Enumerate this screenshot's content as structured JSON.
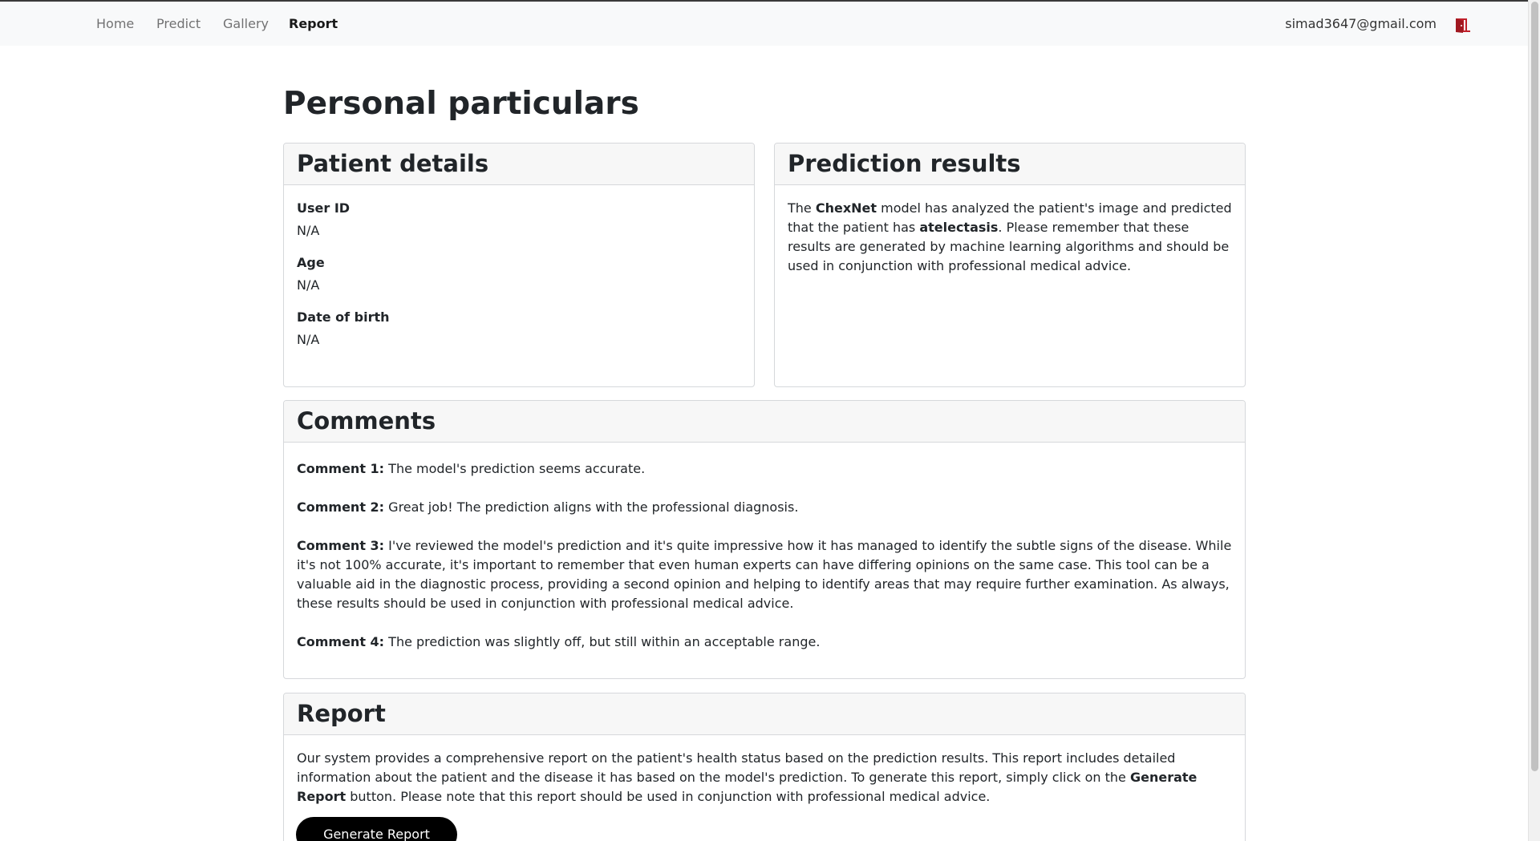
{
  "nav": {
    "items": [
      {
        "label": "Home",
        "active": false
      },
      {
        "label": "Predict",
        "active": false
      },
      {
        "label": "Gallery",
        "active": false
      },
      {
        "label": "Report",
        "active": true
      }
    ],
    "user_email": "simad3647@gmail.com",
    "logout_icon": "logout-door-icon",
    "logout_color": "#c0202a"
  },
  "page": {
    "title": "Personal particulars"
  },
  "patient": {
    "header": "Patient details",
    "fields": [
      {
        "label": "User ID",
        "value": "N/A"
      },
      {
        "label": "Age",
        "value": "N/A"
      },
      {
        "label": "Date of birth",
        "value": "N/A"
      }
    ]
  },
  "prediction": {
    "header": "Prediction results",
    "text_1": "The ",
    "model": "ChexNet",
    "text_2": " model has analyzed the patient's image and predicted that the patient has ",
    "disease": "atelectasis",
    "text_3": ". Please remember that these results are generated by machine learning algorithms and should be used in conjunction with professional medical advice."
  },
  "comments": {
    "header": "Comments",
    "items": [
      {
        "label": "Comment 1:",
        "text": " The model's prediction seems accurate."
      },
      {
        "label": "Comment 2:",
        "text": " Great job! The prediction aligns with the professional diagnosis."
      },
      {
        "label": "Comment 3:",
        "text": " I've reviewed the model's prediction and it's quite impressive how it has managed to identify the subtle signs of the disease. While it's not 100% accurate, it's important to remember that even human experts can have differing opinions on the same case. This tool can be a valuable aid in the diagnostic process, providing a second opinion and helping to identify areas that may require further examination. As always, these results should be used in conjunction with professional medical advice."
      },
      {
        "label": "Comment 4:",
        "text": " The prediction was slightly off, but still within an acceptable range."
      }
    ]
  },
  "report": {
    "header": "Report",
    "text_1": "Our system provides a comprehensive report on the patient's health status based on the prediction results. This report includes detailed information about the patient and the disease it has based on the model's prediction. To generate this report, simply click on the ",
    "button_ref": "Generate Report",
    "text_2": " button. Please note that this report should be used in conjunction with professional medical advice.",
    "button_label": "Generate Report"
  }
}
